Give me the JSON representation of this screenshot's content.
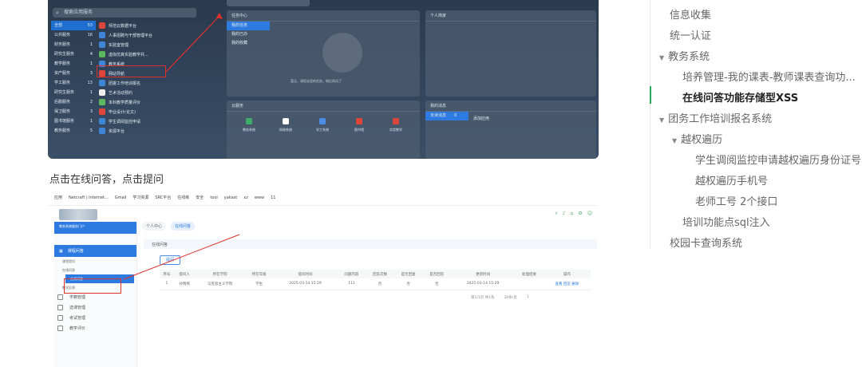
{
  "screenshot1": {
    "search_placeholder": "搜索应用服务",
    "categories": [
      {
        "name": "全部",
        "count": "53"
      },
      {
        "name": "公共服务",
        "count": "16"
      },
      {
        "name": "财务服务",
        "count": "1"
      },
      {
        "name": "研究生服务",
        "count": "4"
      },
      {
        "name": "教学服务",
        "count": "1"
      },
      {
        "name": "资产服务",
        "count": "3"
      },
      {
        "name": "学工服务",
        "count": "13"
      },
      {
        "name": "研究生服务",
        "count": "1"
      },
      {
        "name": "后勤服务",
        "count": "2"
      },
      {
        "name": "保卫服务",
        "count": "3"
      },
      {
        "name": "图书馆服务",
        "count": "1"
      },
      {
        "name": "教务服务",
        "count": "5"
      }
    ],
    "apps": [
      {
        "name": "师范云数据平台",
        "color": "#e0453a"
      },
      {
        "name": "人事招聘与干部管理平台",
        "color": "#3f86d9"
      },
      {
        "name": "实验室管理",
        "color": "#3f86d9"
      },
      {
        "name": "虚拟仿真实验教学共...",
        "color": "#5cb85c"
      },
      {
        "name": "教务系统",
        "color": "#3f86d9"
      },
      {
        "name": "网站导航",
        "color": "#e0453a"
      },
      {
        "name": "团委工作培训报名",
        "color": "#3f86d9"
      },
      {
        "name": "艺术活动预约",
        "color": "#f0f0f0"
      },
      {
        "name": "本科教学质量评价",
        "color": "#5cb85c"
      },
      {
        "name": "毕业设计(论文)",
        "color": "#e0453a"
      },
      {
        "name": "学生调阅监控申请",
        "color": "#3f86d9"
      },
      {
        "name": "资源平台",
        "color": "#3f86d9"
      }
    ],
    "task_panel": {
      "title": "任务中心",
      "items": [
        "我的任务",
        "我的已办",
        "我的收藏"
      ],
      "empty_text": "暂无，请您去您的任务，稍后再试了"
    },
    "personal_panel": {
      "title": "个人简家"
    },
    "cloud_panel": {
      "title": "云服务",
      "icons": [
        {
          "name": "教务系统",
          "color": "#3fae6a"
        },
        {
          "name": "网络系统",
          "color": "#ffffff"
        },
        {
          "name": "学工系统",
          "color": "#4a8ee6"
        },
        {
          "name": "图书馆",
          "color": "#e0453a"
        },
        {
          "name": "实验教学",
          "color": "#e0453a"
        }
      ]
    },
    "message_panel": {
      "title": "我的消息",
      "row_label": "未读消息",
      "row_count": "0",
      "row2": "添加应用"
    }
  },
  "caption": "点击在线问答，点击提问",
  "screenshot2": {
    "bookmarks": [
      "应用",
      "Netcraft | Internet...",
      "Gmail",
      "学习资源",
      "SRC平台",
      "在线练",
      "安全",
      "tool",
      "yakast",
      "xz",
      "www",
      "11"
    ],
    "sidebar_top": "教务系统服务门户",
    "sidebar_group": "课程问答",
    "sidebar_subs": [
      "课堂提问",
      "在线问答",
      "在线问答",
      "教学反馈"
    ],
    "sidebar_items": [
      "学籍管理",
      "选课管理",
      "考试管理",
      "教学评价"
    ],
    "tabs": [
      "个人中心",
      "在线问答"
    ],
    "breadcrumb": "在线问答",
    "ask_button": "提问",
    "table_headers": [
      "序号",
      "提问人",
      "所在学院",
      "所在年级",
      "提问时间",
      "问题内容",
      "回答次数",
      "是否回复",
      "是否回答",
      "更新时间",
      "处理结果",
      "操作"
    ],
    "table_row": [
      "1",
      "孙晓燕",
      "马克思主义学院",
      "学生",
      "2025-03-14 15:29",
      "111",
      "否",
      "否",
      "否",
      "2025-03-14 15:29",
      "",
      "查看 回答 删除"
    ],
    "pager": [
      "第1/1页 共1条",
      "20条/页",
      "1"
    ]
  },
  "toc": [
    {
      "label": "信息收集",
      "level": 0,
      "twisty": ""
    },
    {
      "label": "统一认证",
      "level": 0,
      "twisty": ""
    },
    {
      "label": "教务系统",
      "level": 0,
      "twisty": "▼"
    },
    {
      "label": "培养管理-我的课表-教师课表查询功...",
      "level": 1,
      "twisty": ""
    },
    {
      "label": "在线问答功能存储型XSS",
      "level": 1,
      "twisty": "",
      "active": true
    },
    {
      "label": "团务工作培训报名系统",
      "level": 0,
      "twisty": "▼"
    },
    {
      "label": "越权遍历",
      "level": 1,
      "twisty": "▼"
    },
    {
      "label": "学生调阅监控申请越权遍历身份证号",
      "level": 2,
      "twisty": ""
    },
    {
      "label": "越权遍历手机号",
      "level": 2,
      "twisty": ""
    },
    {
      "label": "老师工号 2个接口",
      "level": 2,
      "twisty": ""
    },
    {
      "label": "培训功能点sql注入",
      "level": 1,
      "twisty": ""
    },
    {
      "label": "校园卡查询系统",
      "level": 0,
      "twisty": ""
    }
  ]
}
